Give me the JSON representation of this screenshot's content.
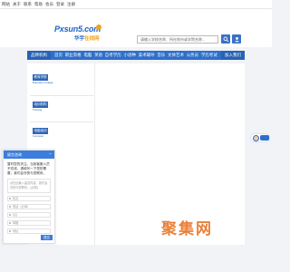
{
  "topbar": {
    "links": [
      "网站",
      "关于",
      "联系",
      "帮助",
      "会员",
      "登录",
      "注册"
    ]
  },
  "header": {
    "logo_main": "Pxsun5.com",
    "logo_sub_a": "华宇",
    "logo_sub_b": "在线网",
    "search_placeholder": "请输入学校名称、所在地市或学院名称..."
  },
  "nav": {
    "home": "品牌机构",
    "items": [
      "首页",
      "职业资格",
      "电脑",
      "英语",
      "自考学历",
      "小语种",
      "美术辅导",
      "音乐",
      "文体艺术",
      "公务员",
      "学历考试"
    ],
    "join": "加入我们"
  },
  "side": {
    "sections": [
      {
        "tag": "教育学院",
        "sub": "Education College"
      },
      {
        "tag": "培训机构",
        "sub": "Training"
      },
      {
        "tag": "电脑培训",
        "sub": "Computer"
      }
    ]
  },
  "form": {
    "title": "留言咨询",
    "message": "暂时您的关注，当前客服人员不在线，请填写一下您的需要，我们会尽快与您联系。",
    "textarea_placeholder": "请在此输入留言内容，我们会尽快与您联系。(必填)",
    "fields": [
      "姓名",
      "电话（必填）",
      "QQ",
      "邮箱",
      "地址"
    ],
    "submit": "提交"
  },
  "watermark": "聚集网",
  "colors": {
    "primary": "#2e6fc9",
    "accent": "#f0a21b",
    "watermark": "#e8762a"
  }
}
